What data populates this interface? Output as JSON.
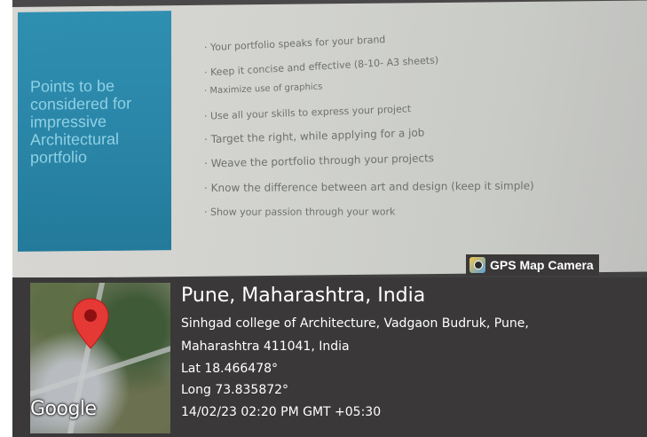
{
  "slide": {
    "side_title_lines": [
      "Points to be",
      "considered for",
      "impressive",
      "Architectural",
      "portfolio"
    ],
    "bullets": [
      "Your portfolio speaks for your brand",
      "Keep it concise and effective (8-10- A3 sheets)",
      "Maximize use of graphics",
      "Use all your skills to express your project",
      "Target the right, while applying for a job",
      "Weave the portfolio through your projects",
      "Know the difference between art and design (keep it simple)",
      "Show your passion through your work"
    ]
  },
  "badge": {
    "label": "GPS Map Camera",
    "icon": "gps-map-camera-icon"
  },
  "location": {
    "title": "Pune, Maharashtra, India",
    "address_line1": "Sinhgad college of Architecture, Vadgaon Budruk, Pune,",
    "address_line2": "Maharashtra 411041, India",
    "lat": "Lat 18.466478°",
    "long": "Long 73.835872°",
    "datetime": "14/02/23 02:20 PM GMT +05:30"
  },
  "map": {
    "watermark": "Google",
    "pin_icon": "map-pin-icon"
  },
  "colors": {
    "panel_blue": "#2f8fb1",
    "pin_red": "#e53935",
    "overlay": "#3a3838"
  }
}
